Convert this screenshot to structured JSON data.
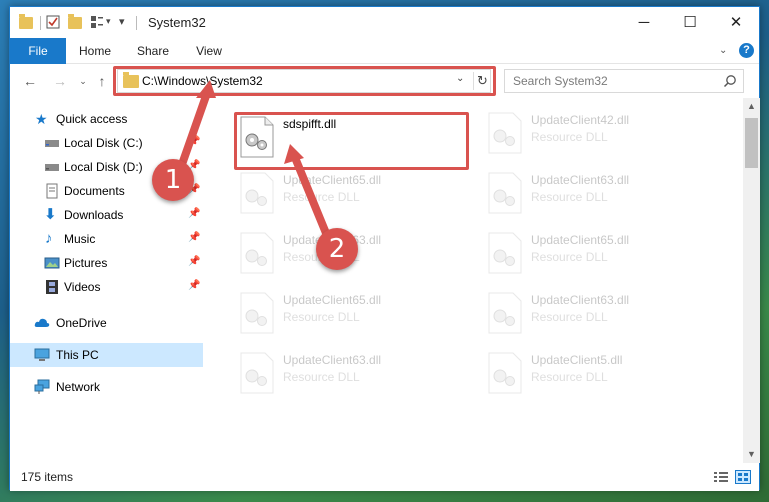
{
  "window": {
    "title": "System32",
    "controls": [
      "minimize",
      "maximize",
      "close"
    ]
  },
  "ribbon": {
    "tabs": [
      "File",
      "Home",
      "Share",
      "View"
    ],
    "help_label": "?"
  },
  "navigation": {
    "address": "C:\\Windows\\System32",
    "search_placeholder": "Search System32"
  },
  "sidebar": {
    "items": [
      {
        "label": "Quick access",
        "icon": "star-icon",
        "pinned": false
      },
      {
        "label": "Local Disk (C:)",
        "icon": "drive-icon",
        "pinned": true
      },
      {
        "label": "Local Disk (D:)",
        "icon": "drive-icon",
        "pinned": true
      },
      {
        "label": "Documents",
        "icon": "documents-icon",
        "pinned": true
      },
      {
        "label": "Downloads",
        "icon": "download-arrow-icon",
        "pinned": true
      },
      {
        "label": "Music",
        "icon": "music-note-icon",
        "pinned": true
      },
      {
        "label": "Pictures",
        "icon": "pictures-icon",
        "pinned": true
      },
      {
        "label": "Videos",
        "icon": "film-icon",
        "pinned": true
      },
      {
        "label": "OneDrive",
        "icon": "cloud-icon",
        "pinned": false
      },
      {
        "label": "This PC",
        "icon": "computer-icon",
        "pinned": false,
        "selected": true
      },
      {
        "label": "Network",
        "icon": "network-icon",
        "pinned": false
      }
    ]
  },
  "files": [
    {
      "name": "sdspifft.dll",
      "type": "",
      "highlighted": true
    },
    {
      "name": "UpdateClient42.dll",
      "type": "Resource DLL"
    },
    {
      "name": "UpdateClient65.dll",
      "type": "Resource DLL"
    },
    {
      "name": "UpdateClient63.dll",
      "type": "Resource DLL"
    },
    {
      "name": "UpdateClient63.dll",
      "type": "Resource DLL"
    },
    {
      "name": "UpdateClient65.dll",
      "type": "Resource DLL"
    },
    {
      "name": "UpdateClient65.dll",
      "type": "Resource DLL"
    },
    {
      "name": "UpdateClient63.dll",
      "type": "Resource DLL"
    },
    {
      "name": "UpdateClient63.dll",
      "type": "Resource DLL"
    },
    {
      "name": "UpdateClient5.dll",
      "type": "Resource DLL"
    }
  ],
  "status": {
    "item_count": "175 items"
  },
  "annotations": [
    {
      "number": "1"
    },
    {
      "number": "2"
    }
  ],
  "colors": {
    "accent": "#1979ca",
    "highlight": "#d9534f",
    "selected_bg": "#cce8ff"
  }
}
